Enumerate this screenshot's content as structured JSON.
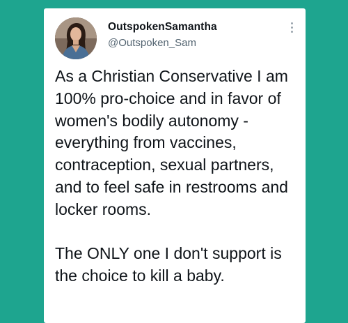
{
  "tweet": {
    "display_name": "OutspokenSamantha",
    "handle": "@Outspoken_Sam",
    "avatar": "profile-photo",
    "more_icon": "more-options-icon",
    "paragraphs": [
      "As a Christian Conservative I am 100% pro-choice and in favor of women's bodily autonomy - everything from vaccines, contraception, sexual partners, and to feel safe in restrooms and locker rooms.",
      "The ONLY one I don't support is the choice to kill a baby."
    ]
  },
  "colors": {
    "background": "#1ea58f",
    "card": "#ffffff",
    "text": "#0f1419",
    "secondary_text": "#536471"
  }
}
